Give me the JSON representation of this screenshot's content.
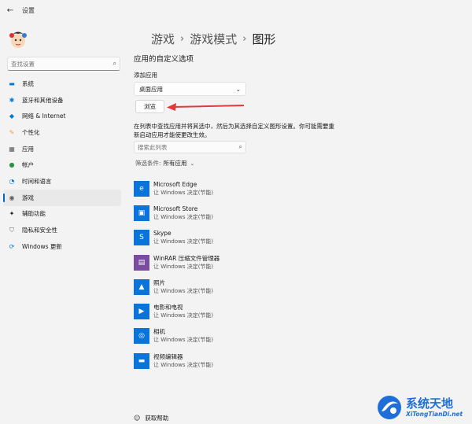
{
  "window": {
    "title": "设置"
  },
  "sidebar": {
    "search_placeholder": "查找设置",
    "items": [
      {
        "label": "系统",
        "icon": "system-icon",
        "color": "#0078d4"
      },
      {
        "label": "蓝牙和其他设备",
        "icon": "bluetooth-icon",
        "color": "#0078d4"
      },
      {
        "label": "网络 & Internet",
        "icon": "network-icon",
        "color": "#0078d4"
      },
      {
        "label": "个性化",
        "icon": "personalization-icon",
        "color": "#e8a33d"
      },
      {
        "label": "应用",
        "icon": "apps-icon",
        "color": "#5b5b5b"
      },
      {
        "label": "帐户",
        "icon": "accounts-icon",
        "color": "#2b9348"
      },
      {
        "label": "时间和语言",
        "icon": "time-language-icon",
        "color": "#0078d4"
      },
      {
        "label": "游戏",
        "icon": "gaming-icon",
        "color": "#5b5b5b",
        "active": true
      },
      {
        "label": "辅助功能",
        "icon": "accessibility-icon",
        "color": "#1a1a1a"
      },
      {
        "label": "隐私和安全性",
        "icon": "privacy-shield-icon",
        "color": "#6b6b6b"
      },
      {
        "label": "Windows 更新",
        "icon": "windows-update-icon",
        "color": "#0078d4"
      }
    ]
  },
  "breadcrumb": {
    "part1": "游戏",
    "part2": "游戏模式",
    "part3": "图形"
  },
  "main": {
    "section_title": "应用的自定义选项",
    "add_app_label": "添加应用",
    "dropdown_value": "桌面应用",
    "browse_label": "浏览",
    "description": "在列表中查找应用并将其选中，然后为其选择自定义图形设置。你可能需要重新启动应用才能使更改生效。",
    "list_search_placeholder": "搜索此列表",
    "filter_label": "筛选条件:",
    "filter_value": "所有应用",
    "apps": [
      {
        "name": "Microsoft Edge",
        "sub": "让 Windows 决定(节能)",
        "icon": "edge-icon",
        "color": "#0a74d9"
      },
      {
        "name": "Microsoft Store",
        "sub": "让 Windows 决定(节能)",
        "icon": "store-icon",
        "color": "#0a74d9"
      },
      {
        "name": "Skype",
        "sub": "让 Windows 决定(节能)",
        "icon": "skype-icon",
        "color": "#0a74d9"
      },
      {
        "name": "WinRAR 压缩文件管理器",
        "sub": "让 Windows 决定(节能)",
        "icon": "winrar-icon",
        "color": "#7a4b9e"
      },
      {
        "name": "照片",
        "sub": "让 Windows 决定(节能)",
        "icon": "photos-icon",
        "color": "#0a74d9"
      },
      {
        "name": "电影和电视",
        "sub": "让 Windows 决定(节能)",
        "icon": "movies-tv-icon",
        "color": "#0a74d9"
      },
      {
        "name": "相机",
        "sub": "让 Windows 决定(节能)",
        "icon": "camera-icon",
        "color": "#0a74d9"
      },
      {
        "name": "视频编辑器",
        "sub": "让 Windows 决定(节能)",
        "icon": "video-editor-icon",
        "color": "#0a74d9"
      }
    ],
    "help_label": "获取帮助"
  },
  "watermark": {
    "title": "系统天地",
    "sub": "XiTongTianDi.net"
  }
}
